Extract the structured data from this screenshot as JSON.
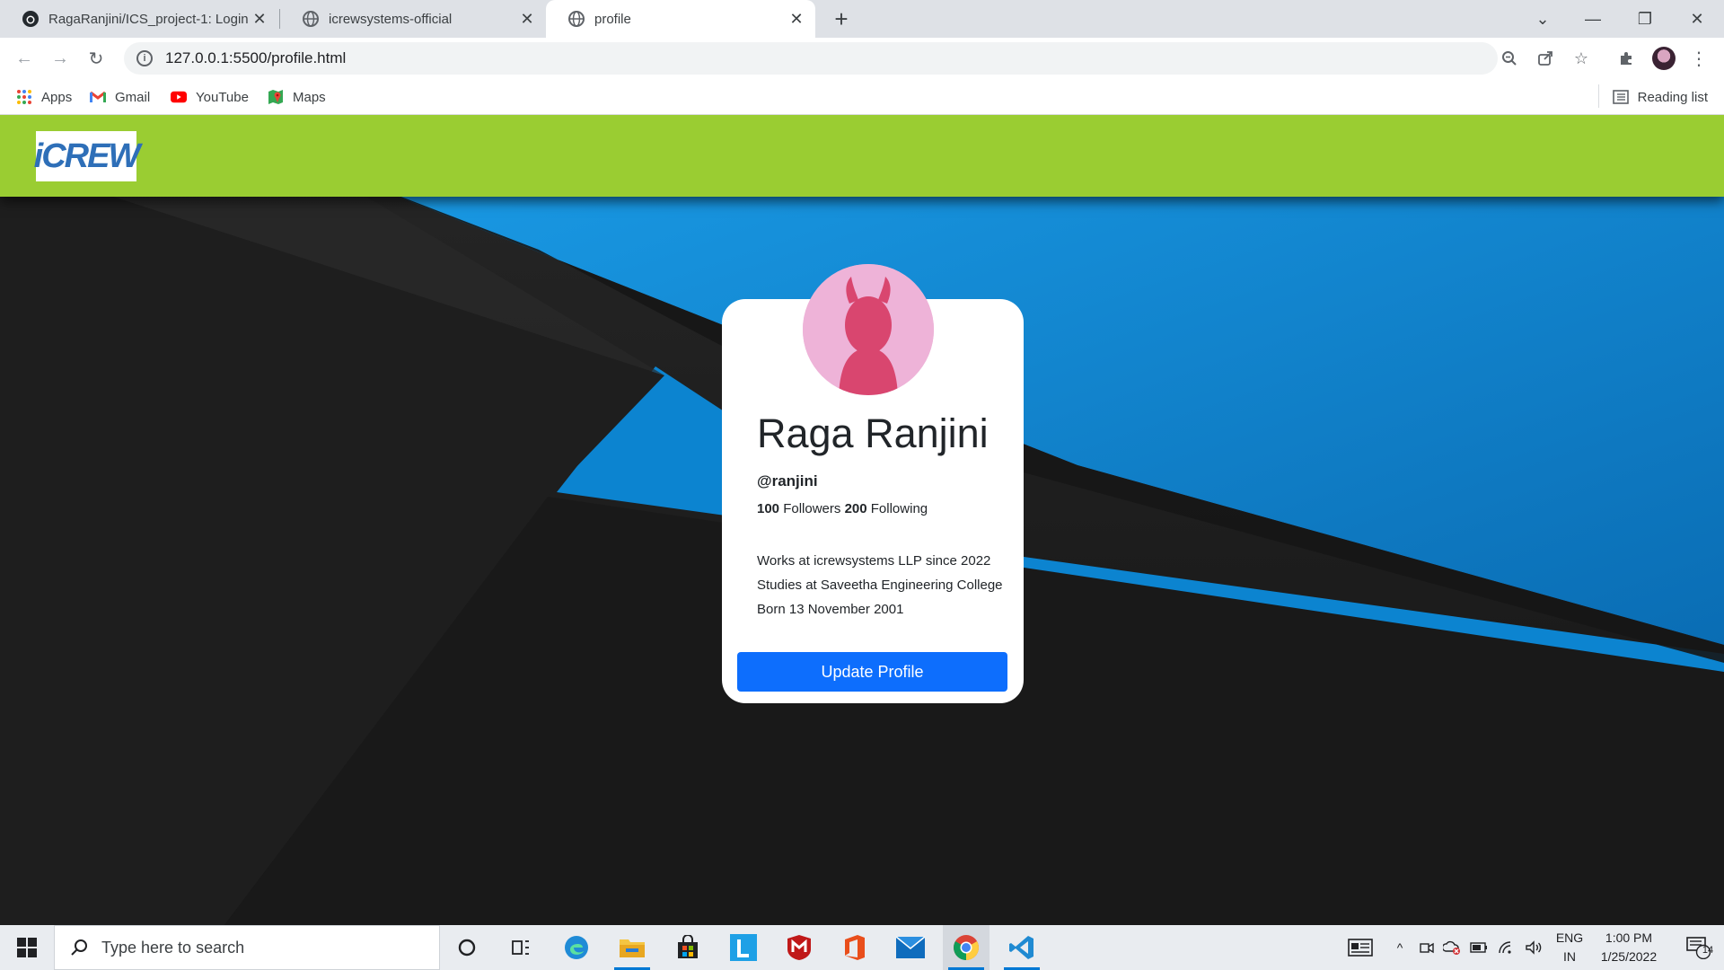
{
  "browser": {
    "tabs": [
      {
        "title": "RagaRanjini/ICS_project-1: Login",
        "icon": "github-icon"
      },
      {
        "title": "icrewsystems-official",
        "icon": "globe-icon"
      },
      {
        "title": "profile",
        "icon": "globe-icon",
        "active": true
      }
    ],
    "url": "127.0.0.1:5500/profile.html",
    "bookmarks": [
      {
        "label": "Apps",
        "icon": "apps-grid-icon"
      },
      {
        "label": "Gmail",
        "icon": "gmail-icon"
      },
      {
        "label": "YouTube",
        "icon": "youtube-icon"
      },
      {
        "label": "Maps",
        "icon": "maps-icon"
      }
    ],
    "reading_list": "Reading list"
  },
  "site": {
    "logo_text": "iCREW",
    "brand_color": "#9acd32"
  },
  "profile": {
    "name": "Raga Ranjini",
    "handle": "@ranjini",
    "followers_count": "100",
    "followers_label": "Followers",
    "following_count": "200",
    "following_label": "Following",
    "bio": [
      "Works at icrewsystems LLP since 2022",
      "Studies at Saveetha Engineering College",
      "Born 13 November 2001"
    ],
    "button_label": "Update Profile",
    "button_color": "#0d6efd"
  },
  "taskbar": {
    "search_placeholder": "Type here to search",
    "language": [
      "ENG",
      "IN"
    ],
    "time": "1:00 PM",
    "date": "1/25/2022",
    "notification_count": "14"
  }
}
